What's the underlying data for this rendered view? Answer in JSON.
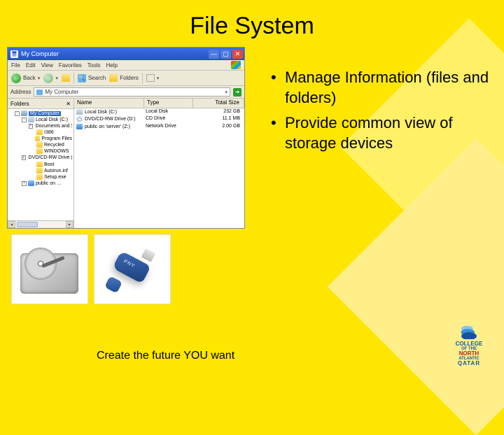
{
  "title": "File System",
  "bullets": [
    "Manage Information (files and folders)",
    "Provide common view of storage devices"
  ],
  "explorer": {
    "window_title": "My Computer",
    "menus": [
      "File",
      "Edit",
      "View",
      "Favorites",
      "Tools",
      "Help"
    ],
    "toolbar": {
      "back": "Back",
      "search": "Search",
      "folders": "Folders"
    },
    "address_label": "Address",
    "address_value": "My Computer",
    "folders_header": "Folders",
    "tree": [
      {
        "level": 1,
        "kind": "pc",
        "expand": "-",
        "label": "My Computer",
        "selected": true
      },
      {
        "level": 2,
        "kind": "drive",
        "expand": "-",
        "label": "Local Disk (C:)"
      },
      {
        "level": 3,
        "kind": "folder",
        "expand": "+",
        "label": "Documents and Settings"
      },
      {
        "level": 3,
        "kind": "folder",
        "expand": "",
        "label": "I386"
      },
      {
        "level": 3,
        "kind": "folder",
        "expand": "",
        "label": "Program Files"
      },
      {
        "level": 3,
        "kind": "folder",
        "expand": "",
        "label": "Recycled"
      },
      {
        "level": 3,
        "kind": "folder",
        "expand": "",
        "label": "WINDOWS"
      },
      {
        "level": 2,
        "kind": "cd",
        "expand": "+",
        "label": "DVD/CD-RW Drive (D:)"
      },
      {
        "level": 3,
        "kind": "folder",
        "expand": "",
        "label": "Boot"
      },
      {
        "level": 3,
        "kind": "folder",
        "expand": "",
        "label": "Autorun.inf"
      },
      {
        "level": 3,
        "kind": "folder",
        "expand": "",
        "label": "Setup.exe"
      },
      {
        "level": 2,
        "kind": "net",
        "expand": "+",
        "label": "public on …"
      }
    ],
    "columns": {
      "name": "Name",
      "type": "Type",
      "size": "Total Size"
    },
    "rows": [
      {
        "icon": "drive",
        "name": "Local Disk (C:)",
        "type": "Local Disk",
        "size": "232 GB"
      },
      {
        "icon": "cd",
        "name": "DVD/CD-RW Drive (D:)",
        "type": "CD Drive",
        "size": "11.1 MB"
      },
      {
        "icon": "net",
        "name": "public on 'server' (Z:)",
        "type": "Network Drive",
        "size": "2.00 GB"
      }
    ]
  },
  "tagline": "Create the future YOU want",
  "usb_brand": "PNY",
  "college": {
    "l1": "COLLEGE",
    "l2": "OF THE",
    "l3": "NORTH",
    "l4": "ATLANTIC",
    "l5": "QATAR"
  }
}
